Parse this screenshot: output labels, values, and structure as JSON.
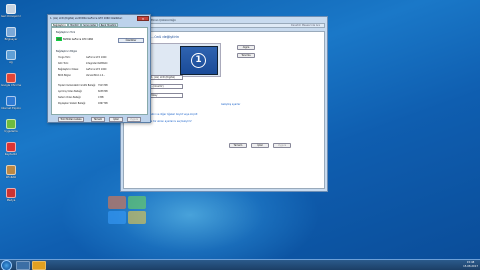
{
  "desktop_icons": [
    {
      "label": "Geri Dönüşüm Kutusu",
      "icon": "recycle-bin-icon",
      "color": "#c6d4e2"
    },
    {
      "label": "Bilgisayar",
      "icon": "computer-icon",
      "color": "#7aa8d8"
    },
    {
      "label": "Ağ",
      "icon": "network-icon",
      "color": "#5f9fd6"
    },
    {
      "label": "Google Chrome",
      "icon": "chrome-icon",
      "color": "#e24536"
    },
    {
      "label": "Internet Explorer",
      "icon": "ie-icon",
      "color": "#2f7bd4"
    },
    {
      "label": "Uygulama",
      "icon": "app-icon",
      "color": "#6dbb3f"
    },
    {
      "label": "Kaydedici",
      "icon": "recorder-icon",
      "color": "#d33"
    },
    {
      "label": "WinRAR",
      "icon": "archive-icon",
      "color": "#b84"
    },
    {
      "label": "Medya",
      "icon": "media-icon",
      "color": "#c33"
    }
  ],
  "resolution_window": {
    "title": "Ekran Çözünürlüğü",
    "address": "Denetim Masası'nda Ara",
    "heading": "...ünü değiştirin",
    "monitor_number": "1",
    "detect_button": "Algıla",
    "identify_button": "Tanımla",
    "display_select": "1. (LG) LCD (Digital)",
    "resolution_select": "...(önerilir)",
    "orientation_select": "Yatay",
    "advanced_link": "Gelişmiş ayarlar",
    "link1": "Metni ve diğer öğeleri büyüt veya küçült",
    "link2": "Ne tür ekran ayarlarını seçmeliyim?",
    "ok_button": "Tamam",
    "cancel_button": "İptal",
    "apply_button": "Uygula"
  },
  "properties_dialog": {
    "title": "1. (LG) LCD (Digital) ve NVIDIA GeForce GTX 1060 Özellikleri",
    "tabs": [
      "Bağdaştırıcı",
      "Monitör",
      "Sorun Gider",
      "Renk Yönetimi"
    ],
    "adapter_type_label": "Bağdaştırıcı Türü",
    "adapter_name": "NVIDIA GeForce GTX 1060",
    "properties_button": "Özellikler",
    "info_header": "Bağdaştırıcı Bilgisi",
    "info": [
      {
        "k": "Yonga Türü:",
        "v": "GeForce GTX 1060"
      },
      {
        "k": "DAC Türü:",
        "v": "Integrated RAMDAC"
      },
      {
        "k": "Bağdaştırıcı Dizesi:",
        "v": "GeForce GTX 1060"
      },
      {
        "k": "BIOS Bilgisi:",
        "v": "Version86.6.1.0..."
      },
      {
        "k": "Toplam Kullanılabilir Grafik Belleği:",
        "v": "7913 MB"
      },
      {
        "k": "Ayrılmış Video Belleği:",
        "v": "6038 MB"
      },
      {
        "k": "Sistem Video Belleği:",
        "v": "0 MB"
      },
      {
        "k": "Paylaşılan Sistem Belleği:",
        "v": "1867 MB"
      }
    ],
    "list_modes_button": "Tüm Modları Listele",
    "ok_button": "Tamam",
    "cancel_button": "İptal",
    "apply_button": "Uygula"
  },
  "taskbar": {
    "time": "15:48",
    "date": "15.08.2017"
  }
}
